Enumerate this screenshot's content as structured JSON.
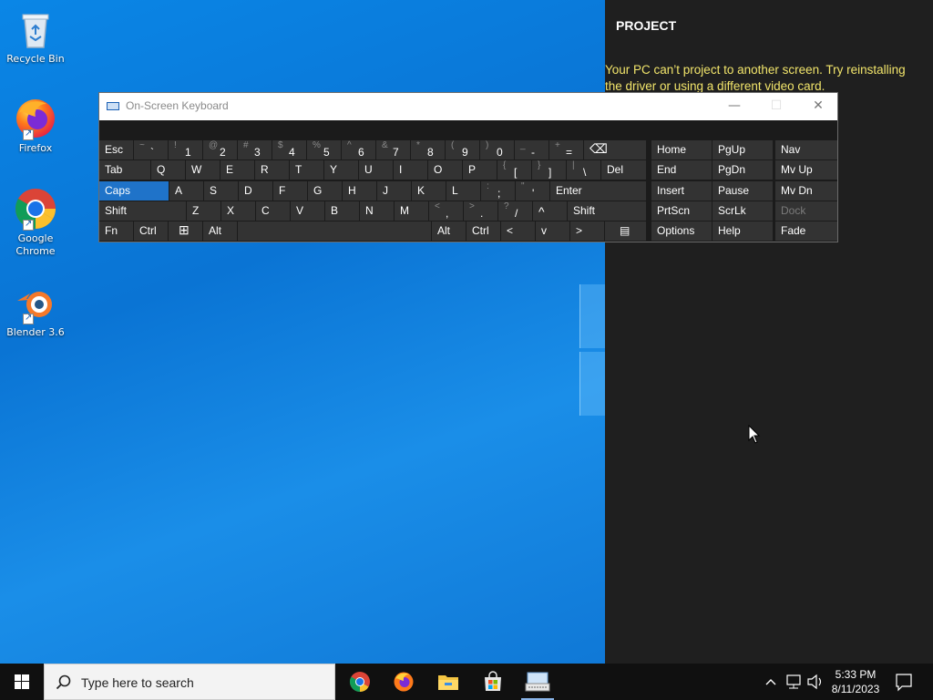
{
  "desktop": {
    "icons": [
      {
        "label": "Recycle Bin"
      },
      {
        "label": "Firefox"
      },
      {
        "label": "Google Chrome"
      },
      {
        "label": "Blender 3.6"
      }
    ]
  },
  "project": {
    "title": "PROJECT",
    "message": "Your PC can’t project to another screen. Try reinstalling the driver or using a different video card."
  },
  "osk": {
    "title": "On-Screen Keyboard",
    "titlebar_buttons": {
      "minimize": "—",
      "maximize": "☐",
      "close": "✕"
    },
    "keys": {
      "esc": "Esc",
      "n1_up": "~",
      "n1": "`",
      "n2_up": "!",
      "n2": "1",
      "n3_up": "@",
      "n3": "2",
      "n4_up": "#",
      "n4": "3",
      "n5_up": "$",
      "n5": "4",
      "n6_up": "%",
      "n6": "5",
      "n7_up": "^",
      "n7": "6",
      "n8_up": "&",
      "n8": "7",
      "n9_up": "*",
      "n9": "8",
      "n10_up": "(",
      "n10": "9",
      "n11_up": ")",
      "n11": "0",
      "n12_up": "_",
      "n12": "-",
      "n13_up": "+",
      "n13": "=",
      "backspace": "⌫",
      "tab": "Tab",
      "q": "Q",
      "w": "W",
      "e": "E",
      "r": "R",
      "t": "T",
      "y": "Y",
      "u": "U",
      "i": "I",
      "o": "O",
      "p": "P",
      "lbrace_up": "{",
      "lbrace": "[",
      "rbrace_up": "}",
      "rbrace": "]",
      "pipe_up": "|",
      "pipe": "\\",
      "del": "Del",
      "caps": "Caps",
      "a": "A",
      "s": "S",
      "d": "D",
      "f": "F",
      "g": "G",
      "h": "H",
      "j": "J",
      "k": "K",
      "l": "L",
      "colon_up": ":",
      "colon": ";",
      "quote_up": "\"",
      "quote": "'",
      "enter": "Enter",
      "shift_l": "Shift",
      "z": "Z",
      "x": "X",
      "c": "C",
      "v": "V",
      "b": "B",
      "n": "N",
      "m": "M",
      "lt_up": "<",
      "lt": ",",
      "gt_up": ">",
      "gt": ".",
      "qm_up": "?",
      "qm": "/",
      "up_arrow": "^",
      "shift_r": "Shift",
      "fn": "Fn",
      "ctrl_l": "Ctrl",
      "win": "⊞",
      "alt_l": "Alt",
      "alt_r": "Alt",
      "ctrl_r": "Ctrl",
      "left_arrow": "<",
      "down_arrow": "v",
      "right_arrow": ">",
      "menu": "▤",
      "home": "Home",
      "pgup": "PgUp",
      "nav": "Nav",
      "end": "End",
      "pgdn": "PgDn",
      "mvup": "Mv Up",
      "insert": "Insert",
      "pause": "Pause",
      "mvdn": "Mv Dn",
      "prtscn": "PrtScn",
      "scrlk": "ScrLk",
      "dock": "Dock",
      "options": "Options",
      "help": "Help",
      "fade": "Fade"
    }
  },
  "taskbar": {
    "search_placeholder": "Type here to search",
    "apps": [
      "chrome-icon",
      "firefox-icon",
      "file-explorer-icon",
      "store-icon",
      "on-screen-keyboard-icon"
    ],
    "clock_time": "5:33 PM",
    "clock_date": "8/11/2023"
  },
  "colors": {
    "accent": "#1f73c9",
    "project_msg": "#f2e56b",
    "key_bg": "#333333"
  }
}
